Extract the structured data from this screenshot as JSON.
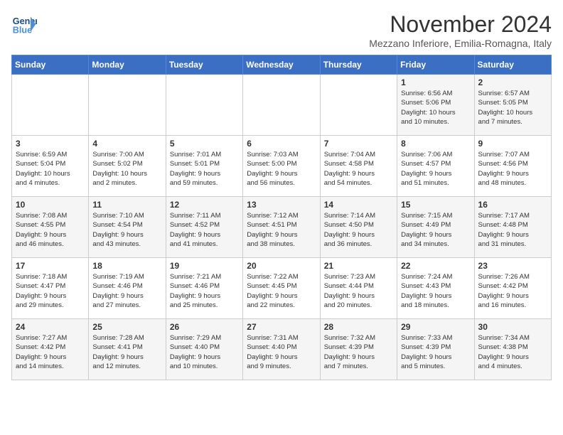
{
  "logo": {
    "line1": "General",
    "line2": "Blue"
  },
  "title": "November 2024",
  "subtitle": "Mezzano Inferiore, Emilia-Romagna, Italy",
  "weekdays": [
    "Sunday",
    "Monday",
    "Tuesday",
    "Wednesday",
    "Thursday",
    "Friday",
    "Saturday"
  ],
  "weeks": [
    [
      {
        "day": "",
        "info": ""
      },
      {
        "day": "",
        "info": ""
      },
      {
        "day": "",
        "info": ""
      },
      {
        "day": "",
        "info": ""
      },
      {
        "day": "",
        "info": ""
      },
      {
        "day": "1",
        "info": "Sunrise: 6:56 AM\nSunset: 5:06 PM\nDaylight: 10 hours\nand 10 minutes."
      },
      {
        "day": "2",
        "info": "Sunrise: 6:57 AM\nSunset: 5:05 PM\nDaylight: 10 hours\nand 7 minutes."
      }
    ],
    [
      {
        "day": "3",
        "info": "Sunrise: 6:59 AM\nSunset: 5:04 PM\nDaylight: 10 hours\nand 4 minutes."
      },
      {
        "day": "4",
        "info": "Sunrise: 7:00 AM\nSunset: 5:02 PM\nDaylight: 10 hours\nand 2 minutes."
      },
      {
        "day": "5",
        "info": "Sunrise: 7:01 AM\nSunset: 5:01 PM\nDaylight: 9 hours\nand 59 minutes."
      },
      {
        "day": "6",
        "info": "Sunrise: 7:03 AM\nSunset: 5:00 PM\nDaylight: 9 hours\nand 56 minutes."
      },
      {
        "day": "7",
        "info": "Sunrise: 7:04 AM\nSunset: 4:58 PM\nDaylight: 9 hours\nand 54 minutes."
      },
      {
        "day": "8",
        "info": "Sunrise: 7:06 AM\nSunset: 4:57 PM\nDaylight: 9 hours\nand 51 minutes."
      },
      {
        "day": "9",
        "info": "Sunrise: 7:07 AM\nSunset: 4:56 PM\nDaylight: 9 hours\nand 48 minutes."
      }
    ],
    [
      {
        "day": "10",
        "info": "Sunrise: 7:08 AM\nSunset: 4:55 PM\nDaylight: 9 hours\nand 46 minutes."
      },
      {
        "day": "11",
        "info": "Sunrise: 7:10 AM\nSunset: 4:54 PM\nDaylight: 9 hours\nand 43 minutes."
      },
      {
        "day": "12",
        "info": "Sunrise: 7:11 AM\nSunset: 4:52 PM\nDaylight: 9 hours\nand 41 minutes."
      },
      {
        "day": "13",
        "info": "Sunrise: 7:12 AM\nSunset: 4:51 PM\nDaylight: 9 hours\nand 38 minutes."
      },
      {
        "day": "14",
        "info": "Sunrise: 7:14 AM\nSunset: 4:50 PM\nDaylight: 9 hours\nand 36 minutes."
      },
      {
        "day": "15",
        "info": "Sunrise: 7:15 AM\nSunset: 4:49 PM\nDaylight: 9 hours\nand 34 minutes."
      },
      {
        "day": "16",
        "info": "Sunrise: 7:17 AM\nSunset: 4:48 PM\nDaylight: 9 hours\nand 31 minutes."
      }
    ],
    [
      {
        "day": "17",
        "info": "Sunrise: 7:18 AM\nSunset: 4:47 PM\nDaylight: 9 hours\nand 29 minutes."
      },
      {
        "day": "18",
        "info": "Sunrise: 7:19 AM\nSunset: 4:46 PM\nDaylight: 9 hours\nand 27 minutes."
      },
      {
        "day": "19",
        "info": "Sunrise: 7:21 AM\nSunset: 4:46 PM\nDaylight: 9 hours\nand 25 minutes."
      },
      {
        "day": "20",
        "info": "Sunrise: 7:22 AM\nSunset: 4:45 PM\nDaylight: 9 hours\nand 22 minutes."
      },
      {
        "day": "21",
        "info": "Sunrise: 7:23 AM\nSunset: 4:44 PM\nDaylight: 9 hours\nand 20 minutes."
      },
      {
        "day": "22",
        "info": "Sunrise: 7:24 AM\nSunset: 4:43 PM\nDaylight: 9 hours\nand 18 minutes."
      },
      {
        "day": "23",
        "info": "Sunrise: 7:26 AM\nSunset: 4:42 PM\nDaylight: 9 hours\nand 16 minutes."
      }
    ],
    [
      {
        "day": "24",
        "info": "Sunrise: 7:27 AM\nSunset: 4:42 PM\nDaylight: 9 hours\nand 14 minutes."
      },
      {
        "day": "25",
        "info": "Sunrise: 7:28 AM\nSunset: 4:41 PM\nDaylight: 9 hours\nand 12 minutes."
      },
      {
        "day": "26",
        "info": "Sunrise: 7:29 AM\nSunset: 4:40 PM\nDaylight: 9 hours\nand 10 minutes."
      },
      {
        "day": "27",
        "info": "Sunrise: 7:31 AM\nSunset: 4:40 PM\nDaylight: 9 hours\nand 9 minutes."
      },
      {
        "day": "28",
        "info": "Sunrise: 7:32 AM\nSunset: 4:39 PM\nDaylight: 9 hours\nand 7 minutes."
      },
      {
        "day": "29",
        "info": "Sunrise: 7:33 AM\nSunset: 4:39 PM\nDaylight: 9 hours\nand 5 minutes."
      },
      {
        "day": "30",
        "info": "Sunrise: 7:34 AM\nSunset: 4:38 PM\nDaylight: 9 hours\nand 4 minutes."
      }
    ]
  ]
}
